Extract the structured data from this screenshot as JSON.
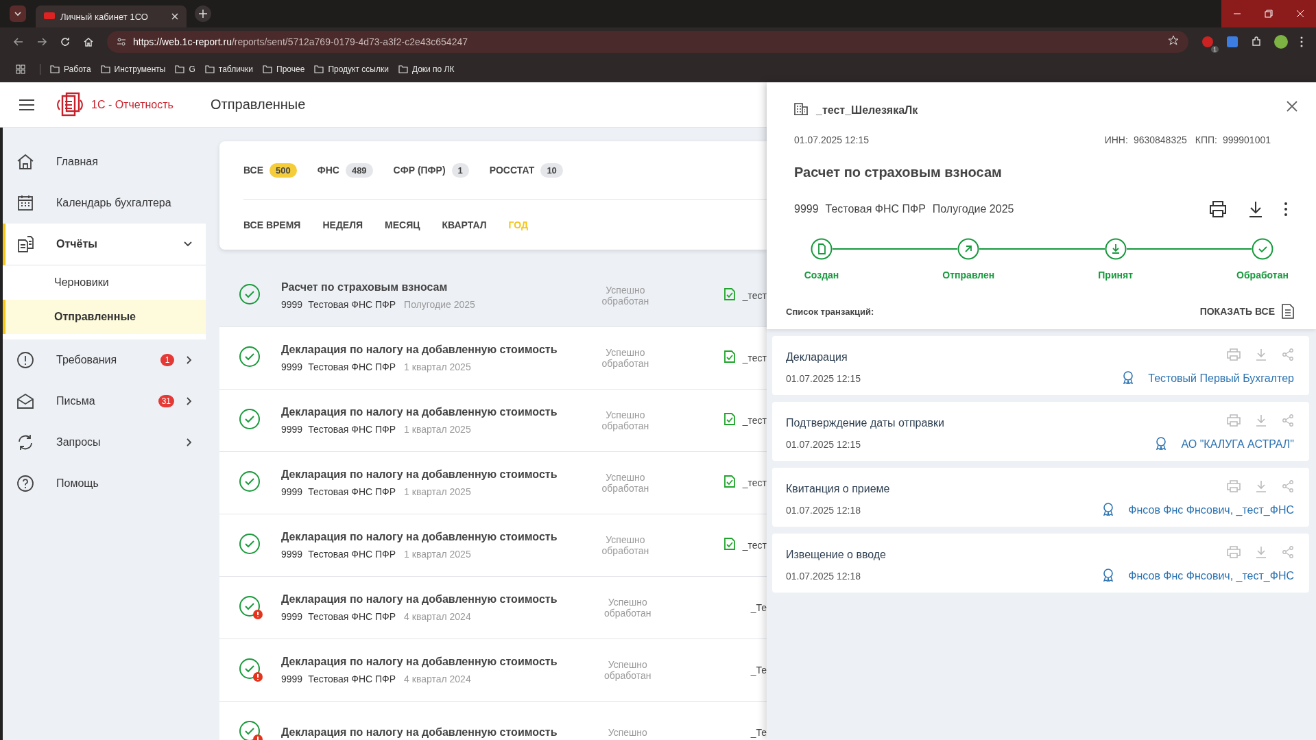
{
  "browser": {
    "tab_title": "Личный кабинет 1СО",
    "url_host": "https://web.1c-report.ru",
    "url_path": "/reports/sent/5712a769-0179-4d73-a3f2-c2e43c654247",
    "extension_badge": "1",
    "bookmarks": [
      "Работа",
      "Инструменты",
      "G",
      "таблички",
      "Прочее",
      "Продукт ссылки",
      "Доки по ЛК"
    ]
  },
  "header": {
    "logo_text": "1С - Отчетность",
    "page_title": "Отправленные"
  },
  "sidebar": {
    "items": [
      {
        "label": "Главная",
        "kind": "link",
        "selected": false
      },
      {
        "label": "Календарь бухгалтера",
        "kind": "link",
        "selected": false
      },
      {
        "label": "Отчёты",
        "kind": "group",
        "selected": true,
        "expanded": true,
        "children": [
          {
            "label": "Черновики",
            "selected": false
          },
          {
            "label": "Отправленные",
            "selected": true
          }
        ]
      },
      {
        "label": "Требования",
        "kind": "submenu",
        "selected": false,
        "badge": "1"
      },
      {
        "label": "Письма",
        "kind": "submenu",
        "selected": false,
        "badge": "31"
      },
      {
        "label": "Запросы",
        "kind": "submenu",
        "selected": false
      },
      {
        "label": "Помощь",
        "kind": "link",
        "selected": false
      }
    ]
  },
  "filters": {
    "agencies": [
      {
        "label": "ВСЕ",
        "count": "500",
        "selected": true
      },
      {
        "label": "ФНС",
        "count": "489",
        "selected": false
      },
      {
        "label": "СФР (ПФР)",
        "count": "1",
        "selected": false
      },
      {
        "label": "РОССТАТ",
        "count": "10",
        "selected": false
      }
    ],
    "periods": [
      {
        "label": "ВСЕ ВРЕМЯ",
        "selected": false
      },
      {
        "label": "НЕДЕЛЯ",
        "selected": false
      },
      {
        "label": "МЕСЯЦ",
        "selected": false
      },
      {
        "label": "КВАРТАЛ",
        "selected": false
      },
      {
        "label": "ГОД",
        "selected": true
      }
    ]
  },
  "reports": [
    {
      "title": "Расчет по страховым взносам",
      "code": "9999",
      "org": "Тестовая ФНС ПФР",
      "period": "Полугодие 2025",
      "status": "Успешно обработан",
      "warning": false,
      "doc_icon": true,
      "sender": "_тест",
      "selected": true
    },
    {
      "title": "Декларация по налогу на добавленную стоимость",
      "code": "9999",
      "org": "Тестовая ФНС ПФР",
      "period": "1 квартал 2025",
      "status": "Успешно обработан",
      "warning": false,
      "doc_icon": true,
      "sender": "_тест",
      "selected": false
    },
    {
      "title": "Декларация по налогу на добавленную стоимость",
      "code": "9999",
      "org": "Тестовая ФНС ПФР",
      "period": "1 квартал 2025",
      "status": "Успешно обработан",
      "warning": false,
      "doc_icon": true,
      "sender": "_тест",
      "selected": false
    },
    {
      "title": "Декларация по налогу на добавленную стоимость",
      "code": "9999",
      "org": "Тестовая ФНС ПФР",
      "period": "1 квартал 2025",
      "status": "Успешно обработан",
      "warning": false,
      "doc_icon": true,
      "sender": "_тест",
      "selected": false
    },
    {
      "title": "Декларация по налогу на добавленную стоимость",
      "code": "9999",
      "org": "Тестовая ФНС ПФР",
      "period": "1 квартал 2025",
      "status": "Успешно обработан",
      "warning": false,
      "doc_icon": true,
      "sender": "_тест",
      "selected": false
    },
    {
      "title": "Декларация по налогу на добавленную стоимость",
      "code": "9999",
      "org": "Тестовая ФНС ПФР",
      "period": "4 квартал 2024",
      "status": "Успешно обработан",
      "warning": true,
      "doc_icon": false,
      "sender": "_Те",
      "selected": false
    },
    {
      "title": "Декларация по налогу на добавленную стоимость",
      "code": "9999",
      "org": "Тестовая ФНС ПФР",
      "period": "4 квартал 2024",
      "status": "Успешно обработан",
      "warning": true,
      "doc_icon": false,
      "sender": "_Те",
      "selected": false
    },
    {
      "title": "Декларация по налогу на добавленную стоимость",
      "status": "Успешно",
      "warning": true,
      "doc_icon": false,
      "sender": "_Те",
      "selected": false
    }
  ],
  "detail": {
    "org_name": "_тест_ШелезякаЛк",
    "date": "01.07.2025 12:15",
    "inn_label": "ИНН:",
    "inn": "9630848325",
    "kpp_label": "КПП:",
    "kpp": "999901001",
    "title": "Расчет по страховым взносам",
    "code": "9999",
    "org": "Тестовая ФНС ПФР",
    "period": "Полугодие 2025",
    "steps": [
      {
        "label": "Создан",
        "done": true
      },
      {
        "label": "Отправлен",
        "done": true
      },
      {
        "label": "Принят",
        "done": true
      },
      {
        "label": "Обработан",
        "done": true
      }
    ],
    "transactions_label": "Список транзакций:",
    "show_all": "ПОКАЗАТЬ ВСЕ",
    "transactions": [
      {
        "title": "Декларация",
        "date": "01.07.2025 12:15",
        "signer": "Тестовый Первый Бухгалтер"
      },
      {
        "title": "Подтверждение даты отправки",
        "date": "01.07.2025 12:15",
        "signer": "АО \"КАЛУГА АСТРАЛ\""
      },
      {
        "title": "Квитанция о приеме",
        "date": "01.07.2025 12:18",
        "signer": "Фнсов Фнс Фнсович, _тест_ФНС"
      },
      {
        "title": "Извещение о вводе",
        "date": "01.07.2025 12:18",
        "signer": "Фнсов Фнс Фнсович, _тест_ФНС"
      }
    ]
  }
}
